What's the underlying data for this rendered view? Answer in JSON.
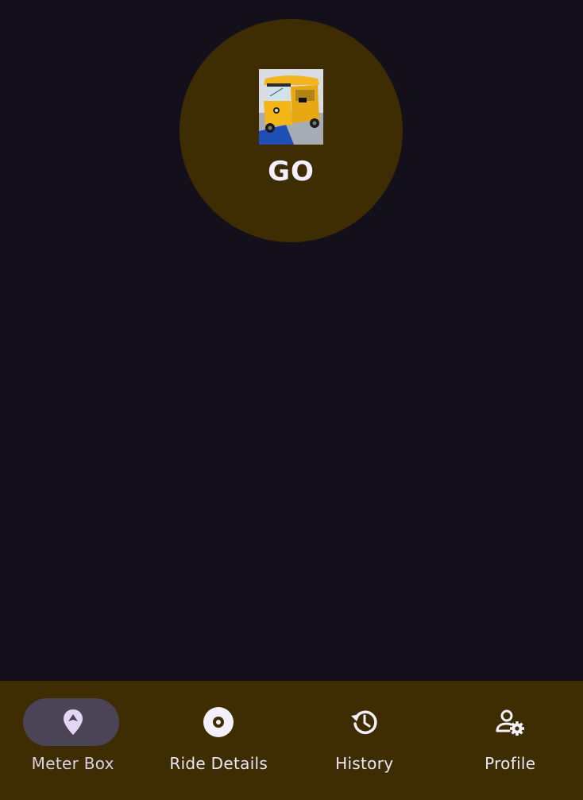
{
  "colors": {
    "background": "#13101c",
    "accent_surface": "#3e2c02",
    "active_pill": "#4b4456",
    "text": "#ece6f5"
  },
  "go_button": {
    "label": "GO",
    "image": "auto-rickshaw-image"
  },
  "bottom_nav": {
    "active_index": 0,
    "items": [
      {
        "label": "Meter Box",
        "icon": "location-pin-icon"
      },
      {
        "label": "Ride Details",
        "icon": "disc-icon"
      },
      {
        "label": "History",
        "icon": "history-icon"
      },
      {
        "label": "Profile",
        "icon": "person-settings-icon"
      }
    ]
  }
}
